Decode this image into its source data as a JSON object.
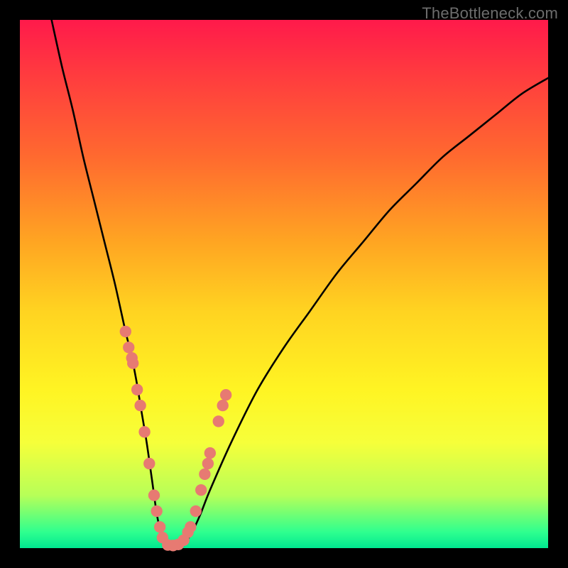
{
  "watermark": "TheBottleneck.com",
  "chart_data": {
    "type": "line",
    "title": "",
    "xlabel": "",
    "ylabel": "",
    "xlim": [
      0,
      100
    ],
    "ylim": [
      0,
      100
    ],
    "grid": false,
    "series": [
      {
        "name": "curve",
        "x": [
          6,
          8,
          10,
          12,
          14,
          16,
          18,
          20,
          21,
          22,
          23,
          24,
          25,
          26,
          27,
          28,
          30,
          32,
          34,
          36,
          40,
          45,
          50,
          55,
          60,
          65,
          70,
          75,
          80,
          85,
          90,
          95,
          100
        ],
        "y": [
          100,
          91,
          83,
          74,
          66,
          58,
          50,
          41,
          37,
          32,
          26,
          20,
          13,
          6,
          2,
          0.5,
          0.5,
          2,
          6,
          11,
          20,
          30,
          38,
          45,
          52,
          58,
          64,
          69,
          74,
          78,
          82,
          86,
          89
        ]
      }
    ],
    "markers": {
      "name": "data-points",
      "color": "#e77a72",
      "radius": 1.1,
      "points": [
        {
          "x": 20.0,
          "y": 41
        },
        {
          "x": 20.6,
          "y": 38
        },
        {
          "x": 21.2,
          "y": 36
        },
        {
          "x": 21.4,
          "y": 35
        },
        {
          "x": 22.2,
          "y": 30
        },
        {
          "x": 22.8,
          "y": 27
        },
        {
          "x": 23.6,
          "y": 22
        },
        {
          "x": 24.5,
          "y": 16
        },
        {
          "x": 25.4,
          "y": 10
        },
        {
          "x": 25.9,
          "y": 7
        },
        {
          "x": 26.5,
          "y": 4
        },
        {
          "x": 27.0,
          "y": 2
        },
        {
          "x": 28.0,
          "y": 0.6
        },
        {
          "x": 29.0,
          "y": 0.5
        },
        {
          "x": 30.0,
          "y": 0.7
        },
        {
          "x": 31.0,
          "y": 1.5
        },
        {
          "x": 31.8,
          "y": 3
        },
        {
          "x": 32.3,
          "y": 4
        },
        {
          "x": 33.3,
          "y": 7
        },
        {
          "x": 34.3,
          "y": 11
        },
        {
          "x": 35.0,
          "y": 14
        },
        {
          "x": 35.6,
          "y": 16
        },
        {
          "x": 36.0,
          "y": 18
        },
        {
          "x": 37.6,
          "y": 24
        },
        {
          "x": 38.4,
          "y": 27
        },
        {
          "x": 39.0,
          "y": 29
        }
      ]
    }
  }
}
